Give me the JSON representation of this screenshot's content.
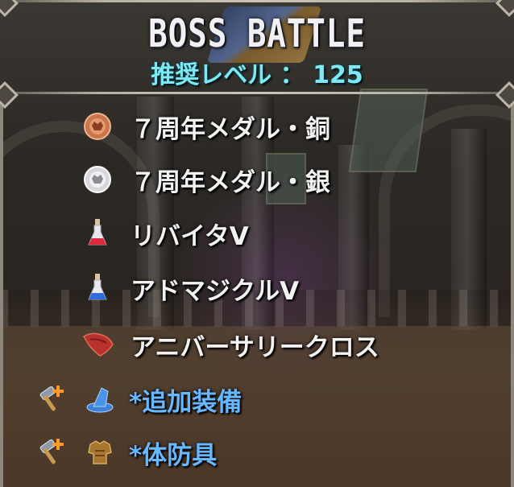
{
  "header": {
    "title": "BOSS BATTLE",
    "level_text": "推奨レベル ： 125"
  },
  "items": [
    {
      "label": "７周年メダル・銅",
      "icon": "bronze-medal-icon",
      "color": "#f2f2f2"
    },
    {
      "label": "７周年メダル・銀",
      "icon": "silver-medal-icon",
      "color": "#f2f2f2"
    },
    {
      "label": "リバイタV",
      "icon": "red-potion-icon",
      "color": "#f2f2f2"
    },
    {
      "label": "アドマジクルV",
      "icon": "blue-potion-icon",
      "color": "#f2f2f2"
    },
    {
      "label": "アニバーサリークロス",
      "icon": "red-cloth-icon",
      "color": "#f2f2f2"
    },
    {
      "label": "*追加装備",
      "icon": "wizard-hat-icon",
      "prefix_icon": "crafting-hammer-icon",
      "color": "#67b8ff"
    },
    {
      "label": "*体防具",
      "icon": "body-armor-icon",
      "prefix_icon": "crafting-hammer-icon",
      "color": "#67b8ff"
    }
  ],
  "colors": {
    "title": "#f1f1f5",
    "level": "#7fe8f2",
    "item_text": "#f2f2f2",
    "equip_text": "#67b8ff"
  }
}
